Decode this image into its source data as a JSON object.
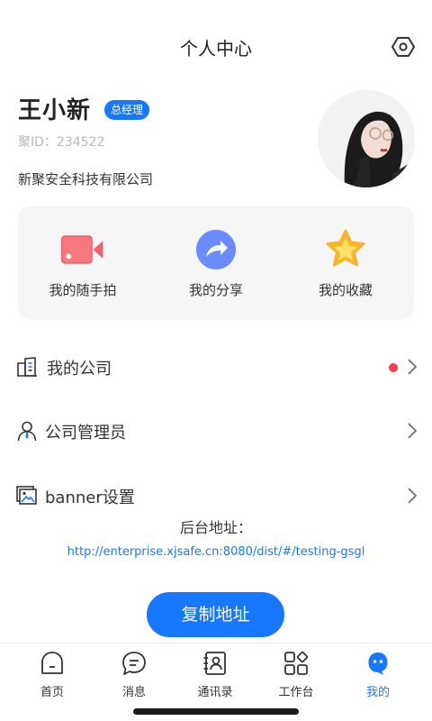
{
  "header": {
    "title": "个人中心",
    "settings_icon": "settings-hexagon-icon"
  },
  "profile": {
    "name": "王小新",
    "role_badge": "总经理",
    "user_id": "聚ID：234522",
    "company": "新聚安全科技有限公司",
    "avatar_icon": "user-avatar-photo"
  },
  "quick_actions": [
    {
      "label": "我的随手拍",
      "icon": "video-camera-icon",
      "color": "#f5606a"
    },
    {
      "label": "我的分享",
      "icon": "share-arrow-icon",
      "color": "#5a7ff5"
    },
    {
      "label": "我的收藏",
      "icon": "star-icon",
      "color": "#f9b52b"
    }
  ],
  "menu": [
    {
      "label": "我的公司",
      "icon": "building-icon",
      "has_dot": true
    },
    {
      "label": "公司管理员",
      "icon": "admin-user-icon",
      "has_dot": false
    },
    {
      "label": "banner设置",
      "icon": "image-icon",
      "has_dot": false
    }
  ],
  "backend": {
    "label": "后台地址：",
    "url": "http://enterprise.xjsafe.cn:8080/dist/#/testing-gsgl"
  },
  "copy_button": {
    "label": "复制地址"
  },
  "tabbar": [
    {
      "label": "首页",
      "icon": "home-icon",
      "active": false
    },
    {
      "label": "消息",
      "icon": "message-icon",
      "active": false
    },
    {
      "label": "通讯录",
      "icon": "contacts-icon",
      "active": false
    },
    {
      "label": "工作台",
      "icon": "workbench-icon",
      "active": false
    },
    {
      "label": "我的",
      "icon": "mine-icon",
      "active": true
    }
  ],
  "colors": {
    "accent": "#1677ff",
    "dot": "#f5404a",
    "card_bg": "#f6f6f6"
  }
}
